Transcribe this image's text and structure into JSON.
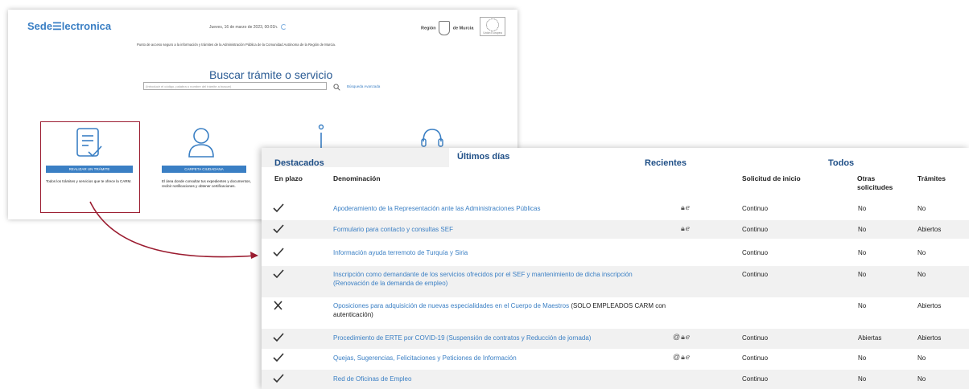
{
  "home": {
    "logo": "Sede☰lectronica",
    "date": "Jueves, 16 de marzo de 2023, 00:01h.",
    "region_pre": "Región",
    "region_post": "de Murcia",
    "eu": "Unión Europea",
    "tagline": "Punto de acceso seguro a la información y trámites de la Administración Pública de la Comunidad Autónoma de la Región de Murcia.",
    "search_title": "Buscar trámite o servicio",
    "search_placeholder": "(Introducir el código, palabra o nombre del trámite a buscar)",
    "advanced_search": "Búsqueda Avanzada",
    "cards": [
      {
        "button": "REALIZAR UN TRÁMITE",
        "desc": "Todos los trámites y servicios que te ofrece la CARM."
      },
      {
        "button": "CARPETA CIUDADANA",
        "desc": "El área donde consultar tus expedientes y documentos, recibir notificaciones y obtener certificaciones."
      }
    ]
  },
  "panel": {
    "tabs": [
      "Destacados",
      "Últimos días",
      "Recientes",
      "Todos"
    ],
    "columns": [
      "En plazo",
      "Denominación",
      "Solicitud de inicio",
      "Otras solicitudes",
      "Trámites"
    ],
    "rows": [
      {
        "in_term": "check",
        "name": "Apoderamiento de la Representación ante las Administraciones Públicas",
        "signs": "🔒︎ℯ",
        "start": "Continuo",
        "other": "No",
        "procedures": "No"
      },
      {
        "in_term": "check",
        "name": "Formulario para contacto y consultas SEF",
        "signs": "🔒︎ℯ",
        "start": "Continuo",
        "other": "No",
        "procedures": "Abiertos"
      },
      {
        "in_term": "check",
        "name": "Información ayuda terremoto de Turquía y Siria",
        "signs": "",
        "start": "Continuo",
        "other": "No",
        "procedures": "No"
      },
      {
        "in_term": "check",
        "name": "Inscripción como demandante de los servicios ofrecidos por el SEF y mantenimiento de dicha inscripción",
        "name2": "(Renovación de la demanda de empleo)",
        "signs": "",
        "start": "Continuo",
        "other": "No",
        "procedures": "No"
      },
      {
        "in_term": "cross",
        "name": "Oposiciones para adquisición de nuevas especialidades en el Cuerpo de Maestros",
        "name_em": "(SOLO EMPLEADOS CARM con",
        "name2": "autenticación)",
        "signs": "",
        "start": "",
        "other": "No",
        "procedures": "Abiertos"
      },
      {
        "in_term": "check",
        "name": "Procedimiento de ERTE por COVID-19 (Suspensión de contratos y Reducción de jornada)",
        "signs": "@🔒︎ℯ",
        "start": "Continuo",
        "other": "Abiertas",
        "procedures": "Abiertos"
      },
      {
        "in_term": "check",
        "name": "Quejas, Sugerencias, Felicitaciones y Peticiones de Información",
        "signs": "@🔒︎ℯ",
        "start": "Continuo",
        "other": "No",
        "procedures": "No"
      },
      {
        "in_term": "check",
        "name": "Red de Oficinas de Empleo",
        "signs": "",
        "start": "Continuo",
        "other": "No",
        "procedures": "No"
      }
    ]
  },
  "colors": {
    "accent": "#3a7fc4",
    "title": "#2a5b94",
    "highlight": "#9b1c30",
    "tab_text": "#1f4f87",
    "row_alt": "#f1f1f1"
  }
}
